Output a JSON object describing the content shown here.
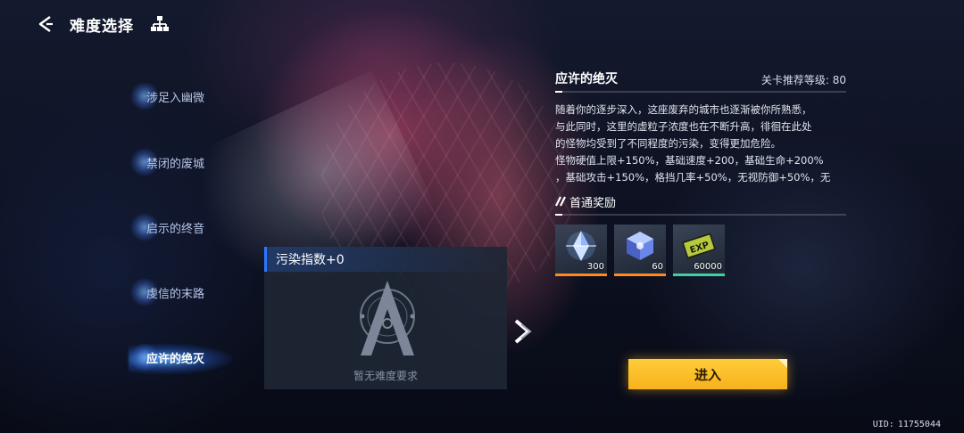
{
  "header": {
    "title": "难度选择"
  },
  "icons": {
    "back": "back-arrow-icon",
    "tree": "hierarchy-icon",
    "next": "chevron-right-icon"
  },
  "difficulties": [
    {
      "label": "涉足入幽微",
      "active": false
    },
    {
      "label": "禁闭的废城",
      "active": false
    },
    {
      "label": "启示的终音",
      "active": false
    },
    {
      "label": "虔信的末路",
      "active": false
    },
    {
      "label": "应许的绝灭",
      "active": true
    }
  ],
  "pollution": {
    "title": "污染指数+0",
    "empty_text": "暂无难度要求"
  },
  "detail": {
    "stage_title": "应许的绝灭",
    "recommended_label": "关卡推荐等级:",
    "recommended_level": "80",
    "description": [
      "随着你的逐步深入，这座废弃的城市也逐渐被你所熟悉，",
      "与此同时，这里的虚粒子浓度也在不断升高，徘徊在此处",
      "的怪物均受到了不同程度的污染，变得更加危险。",
      "怪物硬值上限+150%，基础速度+200，基础生命+200%",
      "，基础攻击+150%，格挡几率+50%，无视防御+50%，无"
    ],
    "reward_title": "首通奖励",
    "rewards": [
      {
        "icon": "crystal-shard-icon",
        "qty": "300",
        "rarity": "orange"
      },
      {
        "icon": "crystal-cube-icon",
        "qty": "60",
        "rarity": "orange"
      },
      {
        "icon": "exp-card-icon",
        "qty": "60000",
        "rarity": "green"
      }
    ]
  },
  "enter_label": "进入",
  "uid": {
    "label": "UID:",
    "value": "11755044"
  },
  "colors": {
    "accent_blue": "#2e76ff",
    "enter_yellow": "#f7b21c",
    "rarity_orange": "#ff8a1f",
    "rarity_green": "#3fd2a0"
  }
}
